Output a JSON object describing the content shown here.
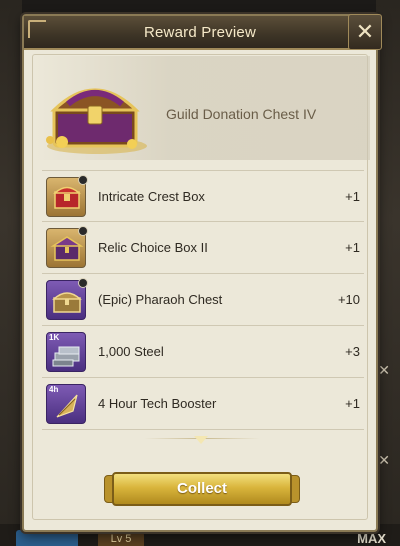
{
  "modal": {
    "title": "Reward Preview",
    "close_icon": "close-icon",
    "chest_name": "Guild Donation Chest IV",
    "chest_icon": "treasure-chest-icon"
  },
  "rewards": [
    {
      "name": "Intricate Crest Box",
      "qty": "+1",
      "icon": "crest-box-icon",
      "frame": "gold",
      "badge": ""
    },
    {
      "name": "Relic Choice Box II",
      "qty": "+1",
      "icon": "relic-box-icon",
      "frame": "gold",
      "badge": ""
    },
    {
      "name": "(Epic)  Pharaoh Chest",
      "qty": "+10",
      "icon": "pharaoh-chest-icon",
      "frame": "purple",
      "badge": ""
    },
    {
      "name": "1,000 Steel",
      "qty": "+3",
      "icon": "steel-icon",
      "frame": "purple",
      "badge": "1K"
    },
    {
      "name": "4 Hour Tech Booster",
      "qty": "+1",
      "icon": "tech-booster-icon",
      "frame": "purple",
      "badge": "4h"
    }
  ],
  "scroll_icon": "chevron-down-icon",
  "collect_label": "Collect",
  "background": {
    "level_label": "Lv 5",
    "max_label": "MAX"
  },
  "colors": {
    "header": "#3d3426",
    "panel": "#ece8d9",
    "button_gold": "#d9b53c",
    "epic_purple": "#5a3a93"
  }
}
